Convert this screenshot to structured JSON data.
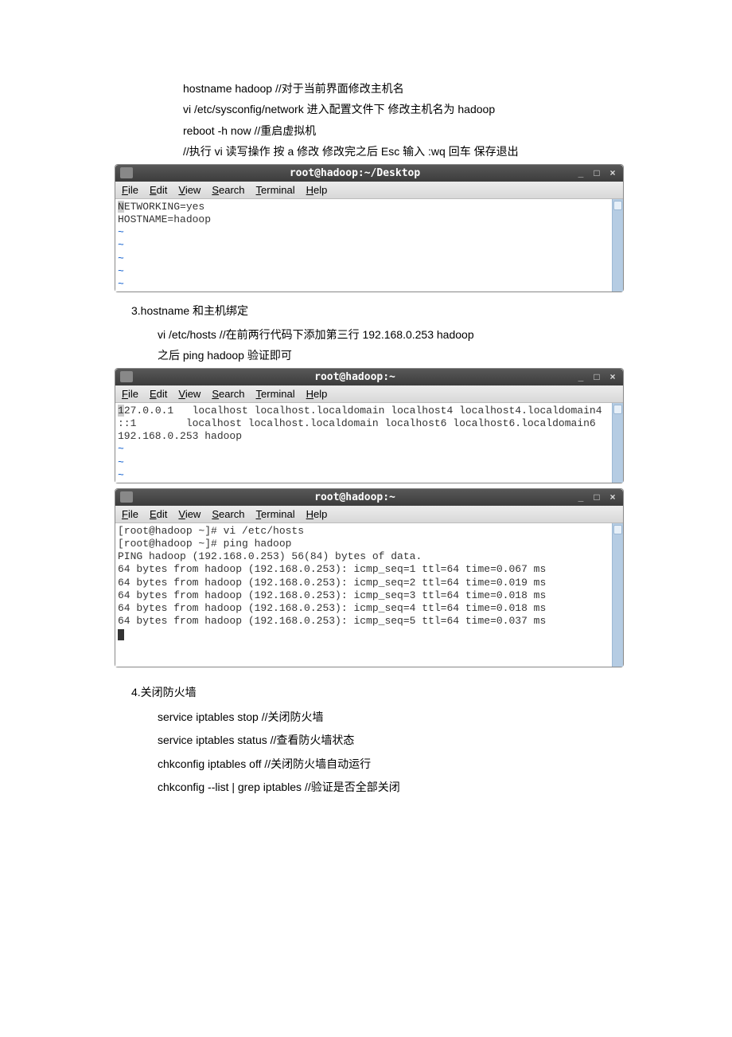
{
  "intro": {
    "line1": "hostname hadoop  //对于当前界面修改主机名",
    "line2": "vi /etc/sysconfig/network  进入配置文件下  修改主机名为 hadoop",
    "line3": "reboot -h now //重启虚拟机",
    "line4": "//执行 vi 读写操作       按 a 修改  修改完之后  Esc   输入  :wq  回车  保存退出"
  },
  "term1": {
    "title": "root@hadoop:~/Desktop",
    "menu": {
      "file": "File",
      "edit": "Edit",
      "view": "View",
      "search": "Search",
      "terminal": "Terminal",
      "help": "Help"
    },
    "content": "NETWORKING=yes\nHOSTNAME=hadoop"
  },
  "sec3": {
    "heading": "3.hostname 和主机绑定",
    "line1": "vi /etc/hosts   //在前两行代码下添加第三行 192.168.0.253 hadoop",
    "line2": "之后  ping hadoop 验证即可"
  },
  "term2": {
    "title": "root@hadoop:~",
    "menu": {
      "file": "File",
      "edit": "Edit",
      "view": "View",
      "search": "Search",
      "terminal": "Terminal",
      "help": "Help"
    },
    "line1_a": "1",
    "line1_b": "27.0.0.1   localhost localhost.localdomain localhost4 localhost4.localdomain4",
    "line2": "::1        localhost localhost.localdomain localhost6 localhost6.localdomain6",
    "line3": "192.168.0.253 hadoop"
  },
  "term3": {
    "title": "root@hadoop:~",
    "menu": {
      "file": "File",
      "edit": "Edit",
      "view": "View",
      "search": "Search",
      "terminal": "Terminal",
      "help": "Help"
    },
    "content": "[root@hadoop ~]# vi /etc/hosts\n[root@hadoop ~]# ping hadoop\nPING hadoop (192.168.0.253) 56(84) bytes of data.\n64 bytes from hadoop (192.168.0.253): icmp_seq=1 ttl=64 time=0.067 ms\n64 bytes from hadoop (192.168.0.253): icmp_seq=2 ttl=64 time=0.019 ms\n64 bytes from hadoop (192.168.0.253): icmp_seq=3 ttl=64 time=0.018 ms\n64 bytes from hadoop (192.168.0.253): icmp_seq=4 ttl=64 time=0.018 ms\n64 bytes from hadoop (192.168.0.253): icmp_seq=5 ttl=64 time=0.037 ms"
  },
  "sec4": {
    "heading": "4.关闭防火墙",
    "line1": "service iptables stop       //关闭防火墙",
    "line2": "service iptables status    //查看防火墙状态",
    "line3": "chkconfig iptables off      //关闭防火墙自动运行",
    "line4": "chkconfig --list | grep iptables        //验证是否全部关闭"
  },
  "tildes": "~"
}
